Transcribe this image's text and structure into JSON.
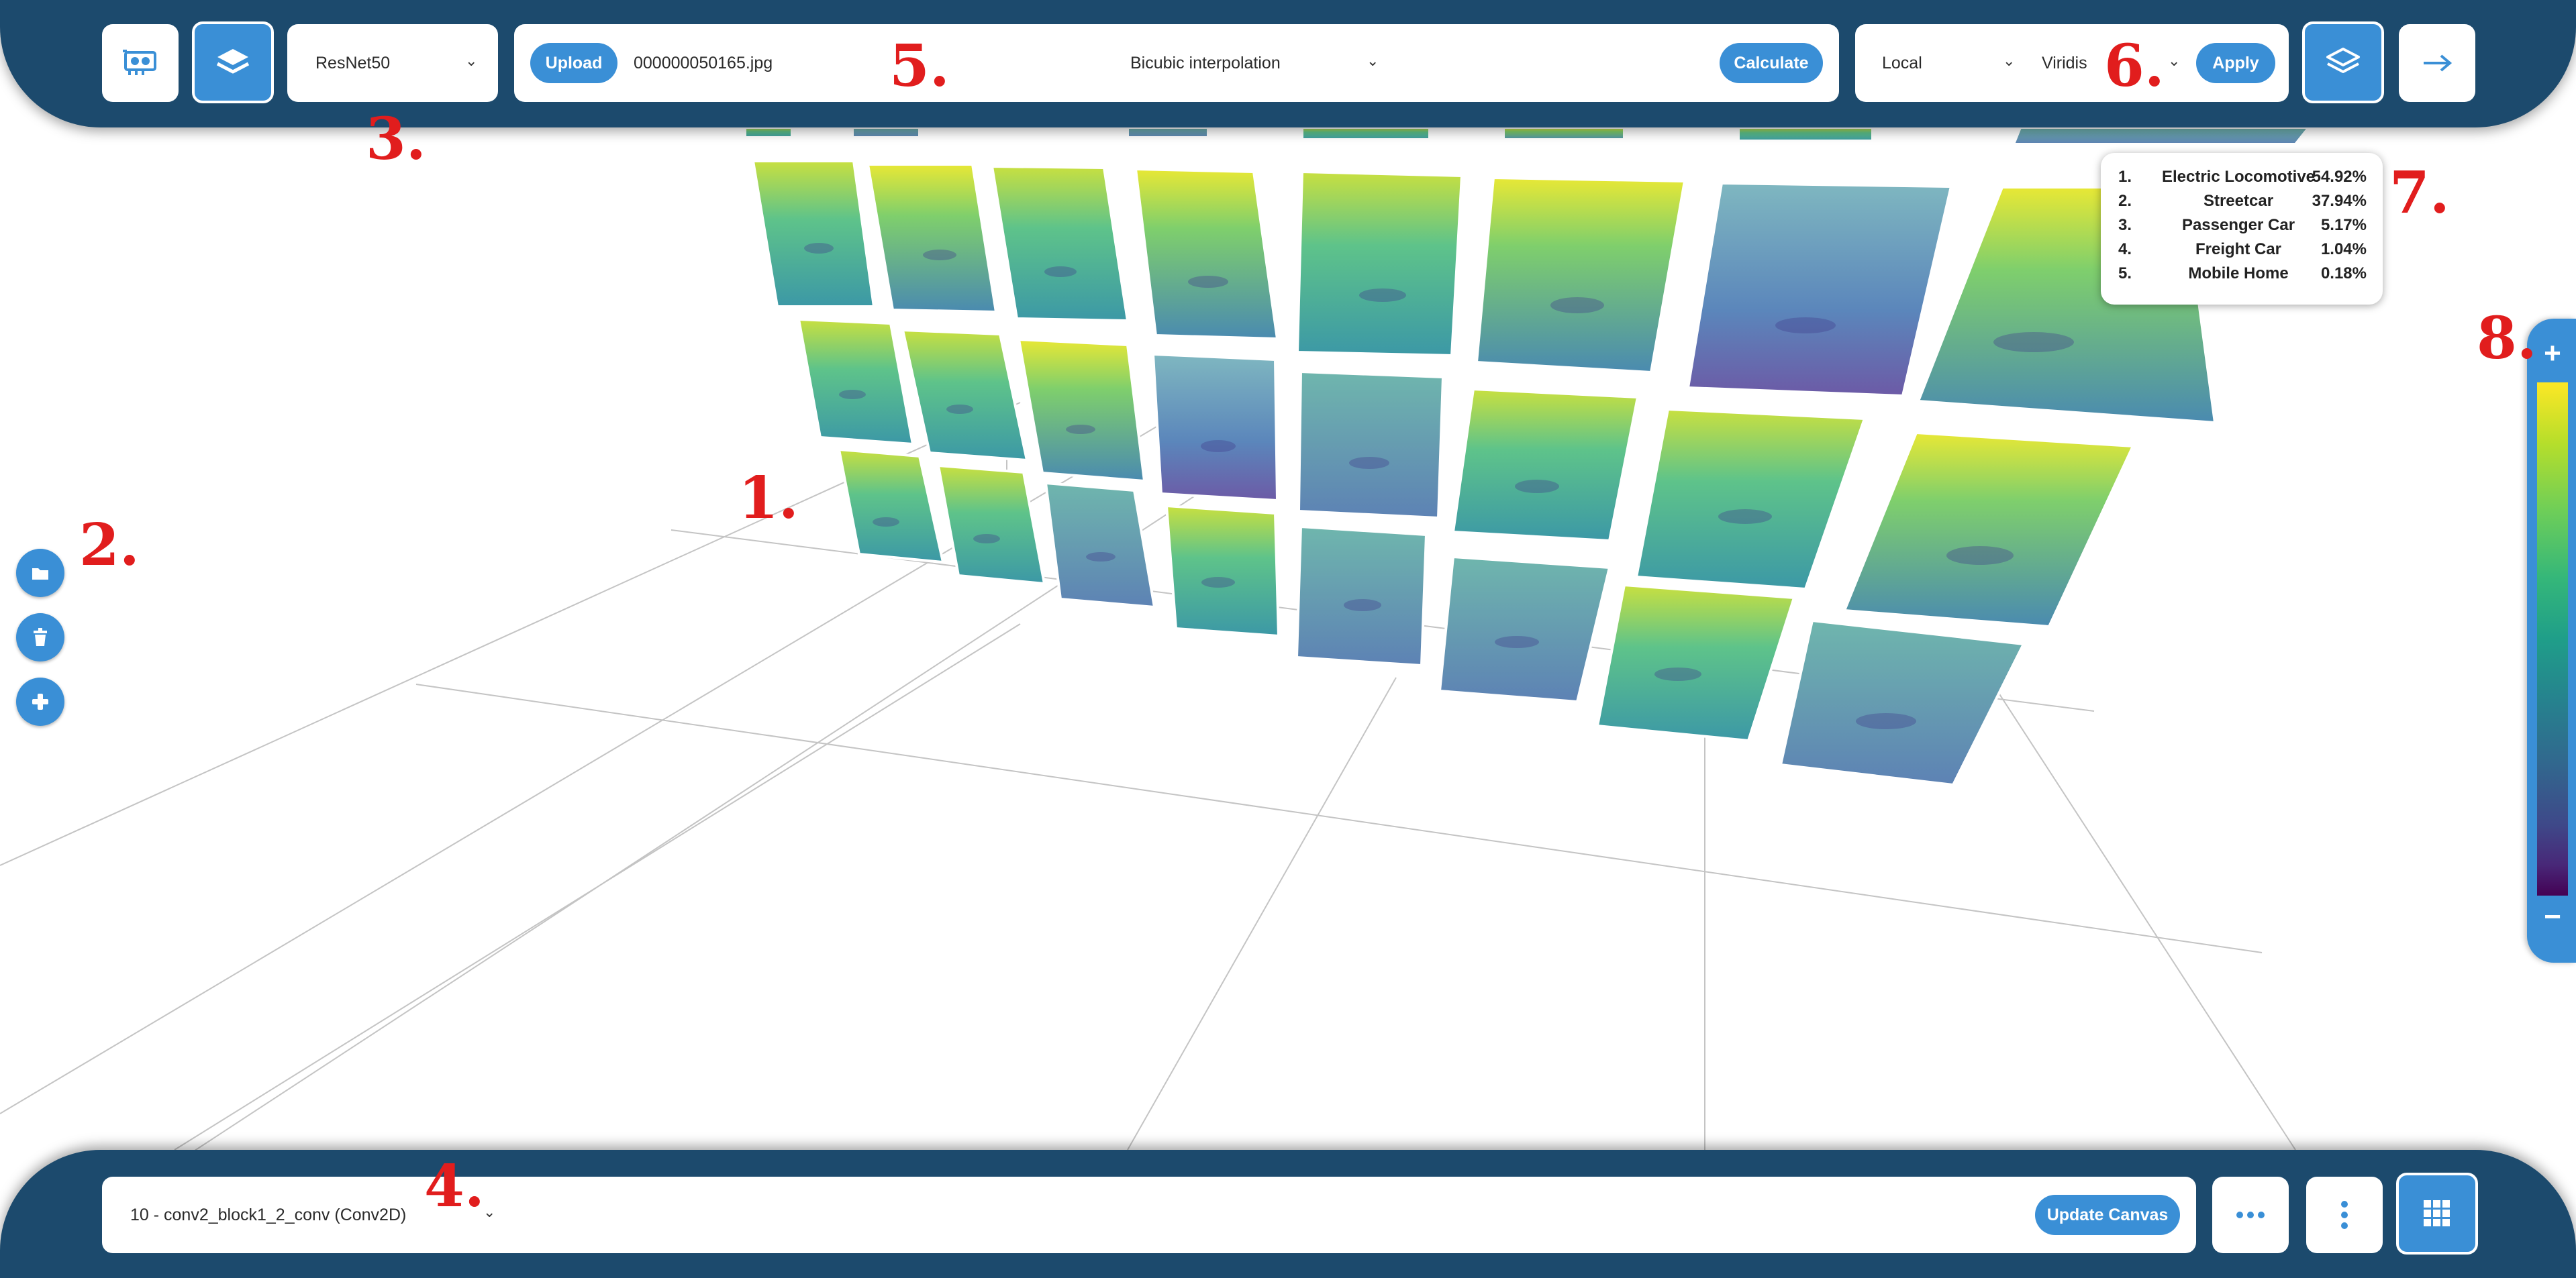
{
  "toolbar": {
    "model_select": "ResNet50",
    "upload_label": "Upload",
    "filename": "000000050165.jpg",
    "interpolation_select": "Bicubic interpolation",
    "calculate_label": "Calculate",
    "scope_select": "Local",
    "colormap_select": "Viridis",
    "apply_label": "Apply"
  },
  "bottom": {
    "layer_select": "10 - conv2_block1_2_conv (Conv2D)",
    "update_label": "Update Canvas"
  },
  "predictions": [
    {
      "rank": "1.",
      "label": "Electric Locomotive",
      "prob": "54.92%"
    },
    {
      "rank": "2.",
      "label": "Streetcar",
      "prob": "37.94%"
    },
    {
      "rank": "3.",
      "label": "Passenger Car",
      "prob": "5.17%"
    },
    {
      "rank": "4.",
      "label": "Freight Car",
      "prob": "1.04%"
    },
    {
      "rank": "5.",
      "label": "Mobile Home",
      "prob": "0.18%"
    }
  ],
  "annotations": {
    "a1": "1.",
    "a2": "2.",
    "a3": "3.",
    "a4": "4.",
    "a5": "5.",
    "a6": "6.",
    "a7": "7.",
    "a8": "8."
  },
  "colorbar": {
    "plus": "+",
    "minus": "−",
    "colormap": "viridis",
    "high_color": "#fde725",
    "low_color": "#440154"
  },
  "icons": {
    "gpu": "gpu-icon",
    "layers": "layers-icon",
    "next": "arrow-right-icon",
    "dots_h": "more-horizontal-icon",
    "dots_v": "more-vertical-icon",
    "grid": "grid-icon",
    "side_folder": "folder-icon",
    "side_trash": "trash-icon",
    "side_plus": "plus-icon"
  },
  "colors": {
    "bar": "#1c4a6d",
    "accent": "#3a8fd6",
    "annotation": "#e11d1d"
  }
}
